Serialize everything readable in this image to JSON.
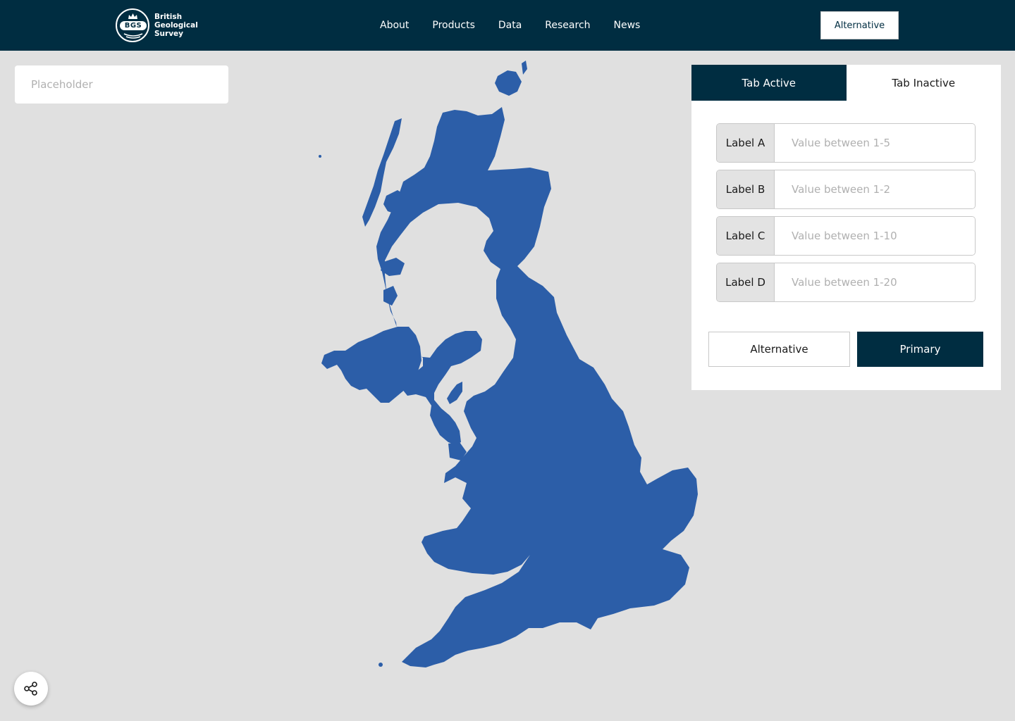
{
  "header": {
    "logo": {
      "line1": "British",
      "line2": "Geological",
      "line3": "Survey",
      "mark": "BGS"
    },
    "nav": [
      {
        "label": "About"
      },
      {
        "label": "Products"
      },
      {
        "label": "Data"
      },
      {
        "label": "Research"
      },
      {
        "label": "News"
      }
    ],
    "action_label": "Alternative"
  },
  "search": {
    "placeholder": "Placeholder",
    "value": ""
  },
  "map": {
    "region": "United Kingdom",
    "fill_color": "#2c5ea8",
    "background_color": "#e0e0e0"
  },
  "panel": {
    "tabs": [
      {
        "label": "Tab Active",
        "active": true
      },
      {
        "label": "Tab Inactive",
        "active": false
      }
    ],
    "fields": [
      {
        "label": "Label A",
        "placeholder": "Value between 1-5",
        "value": ""
      },
      {
        "label": "Label B",
        "placeholder": "Value between 1-2",
        "value": ""
      },
      {
        "label": "Label C",
        "placeholder": "Value between 1-10",
        "value": ""
      },
      {
        "label": "Label D",
        "placeholder": "Value between 1-20",
        "value": ""
      }
    ],
    "secondary_button": "Alternative",
    "primary_button": "Primary"
  },
  "share": {
    "icon": "share-icon"
  },
  "colors": {
    "brand_dark": "#002d41",
    "map_blue": "#2c5ea8"
  }
}
